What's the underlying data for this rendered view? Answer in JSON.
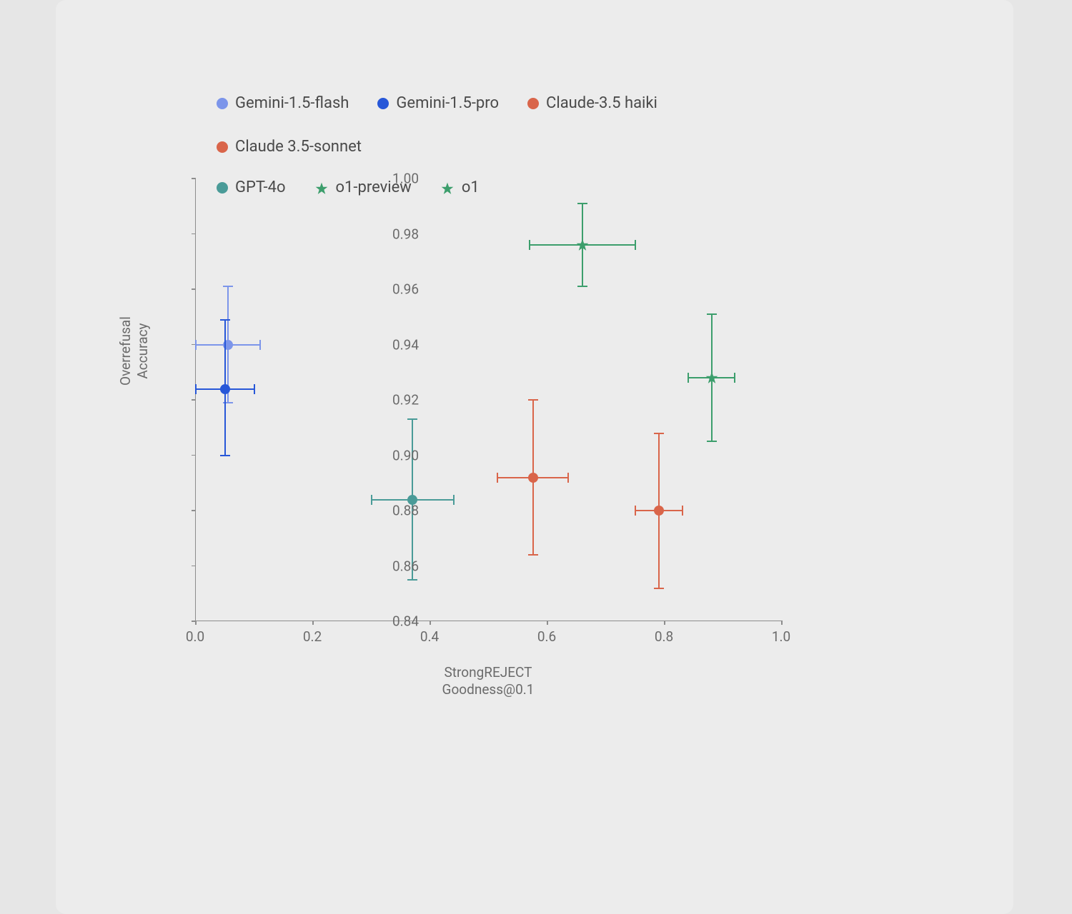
{
  "chart_data": {
    "type": "scatter",
    "xlabel": "StrongREJECT\nGoodness@0.1",
    "ylabel": "Overrefusal\nAccuracy",
    "xlim": [
      0.0,
      1.0
    ],
    "ylim": [
      0.84,
      1.0
    ],
    "xticks": [
      0.0,
      0.2,
      0.4,
      0.6,
      0.8,
      1.0
    ],
    "yticks": [
      0.84,
      0.86,
      0.88,
      0.9,
      0.92,
      0.94,
      0.96,
      0.98,
      1.0
    ],
    "series": [
      {
        "name": "Gemini-1.5-flash",
        "marker": "dot",
        "color": "#7c95ea",
        "x": 0.055,
        "y": 0.94,
        "xerr": [
          0.055,
          0.055
        ],
        "yerr": [
          0.021,
          0.021
        ]
      },
      {
        "name": "Gemini-1.5-pro",
        "marker": "dot",
        "color": "#2757d8",
        "x": 0.05,
        "y": 0.924,
        "xerr": [
          0.05,
          0.05
        ],
        "yerr": [
          0.024,
          0.025
        ]
      },
      {
        "name": "Claude-3.5 haiki",
        "marker": "dot",
        "color": "#d9654a",
        "x": 0.575,
        "y": 0.892,
        "xerr": [
          0.06,
          0.06
        ],
        "yerr": [
          0.028,
          0.028
        ]
      },
      {
        "name": "Claude 3.5-sonnet",
        "marker": "dot",
        "color": "#d9654a",
        "x": 0.79,
        "y": 0.88,
        "xerr": [
          0.04,
          0.04
        ],
        "yerr": [
          0.028,
          0.028
        ]
      },
      {
        "name": "GPT-4o",
        "marker": "dot",
        "color": "#4a9b98",
        "x": 0.37,
        "y": 0.884,
        "xerr": [
          0.07,
          0.07
        ],
        "yerr": [
          0.029,
          0.029
        ]
      },
      {
        "name": "o1-preview",
        "marker": "star",
        "color": "#3c9e6c",
        "x": 0.66,
        "y": 0.976,
        "xerr": [
          0.09,
          0.09
        ],
        "yerr": [
          0.015,
          0.015
        ]
      },
      {
        "name": "o1",
        "marker": "star",
        "color": "#3c9e6c",
        "x": 0.88,
        "y": 0.928,
        "xerr": [
          0.04,
          0.04
        ],
        "yerr": [
          0.023,
          0.023
        ]
      }
    ],
    "legend_markers": {
      "Gemini-1.5-flash": "#7c95ea",
      "Gemini-1.5-pro": "#2757d8",
      "Claude-3.5 haiki": "#d9654a",
      "Claude 3.5-sonnet": "#d9654a",
      "GPT-4o": "#4a9b98",
      "o1-preview": "#3c9e6c",
      "o1": "#3c9e6c"
    }
  },
  "xtick_labels": {
    "t0": "0.0",
    "t1": "0.2",
    "t2": "0.4",
    "t3": "0.6",
    "t4": "0.8",
    "t5": "1.0"
  },
  "ytick_labels": {
    "t0": "0.84",
    "t1": "0.86",
    "t2": "0.88",
    "t3": "0.90",
    "t4": "0.92",
    "t5": "0.94",
    "t6": "0.96",
    "t7": "0.98",
    "t8": "1.00"
  }
}
